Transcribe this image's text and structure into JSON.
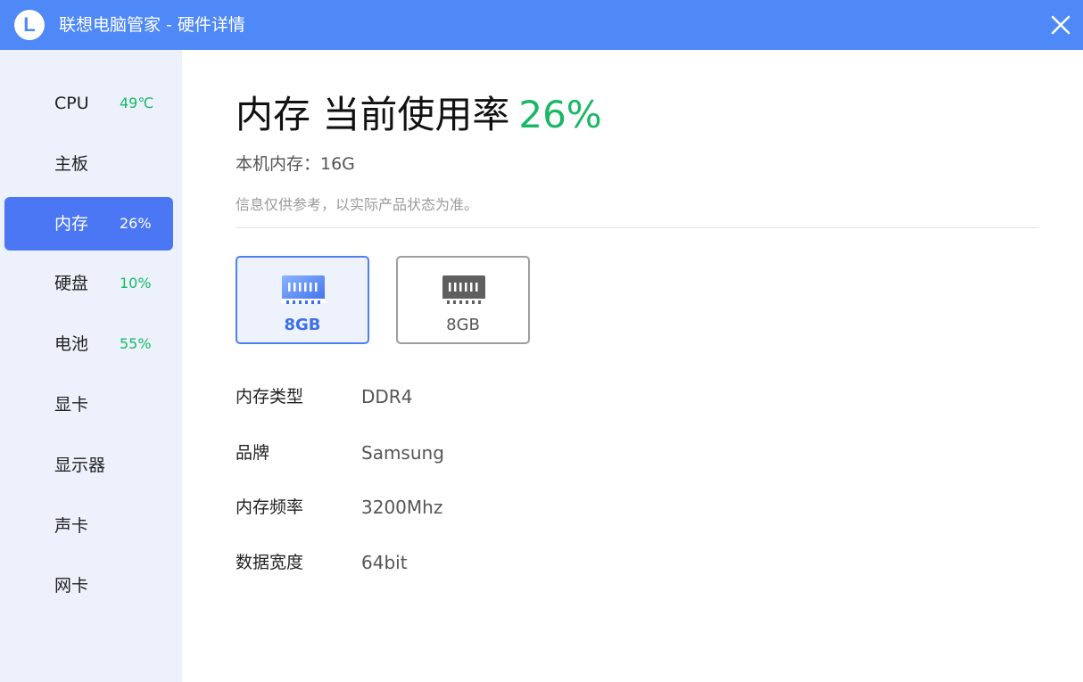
{
  "window": {
    "title": "联想电脑管家 - 硬件详情",
    "logo_letter": "L",
    "accent_color": "#4f88f7"
  },
  "sidebar": {
    "items": [
      {
        "label": "CPU",
        "value": "49℃",
        "active": false
      },
      {
        "label": "主板",
        "value": "",
        "active": false
      },
      {
        "label": "内存",
        "value": "26%",
        "active": true
      },
      {
        "label": "硬盘",
        "value": "10%",
        "active": false
      },
      {
        "label": "电池",
        "value": "55%",
        "active": false
      },
      {
        "label": "显卡",
        "value": "",
        "active": false
      },
      {
        "label": "显示器",
        "value": "",
        "active": false
      },
      {
        "label": "声卡",
        "value": "",
        "active": false
      },
      {
        "label": "网卡",
        "value": "",
        "active": false
      }
    ]
  },
  "main": {
    "heading": "内存 当前使用率",
    "usage_percent": "26%",
    "total_memory": "本机内存：16G",
    "disclaimer": "信息仅供参考，以实际产品状态为准。",
    "slots": [
      {
        "label": "8GB",
        "icon": "ram-module-icon",
        "selected": true
      },
      {
        "label": "8GB",
        "icon": "ram-module-icon",
        "selected": false
      }
    ],
    "specs": [
      {
        "key": "内存类型",
        "value": "DDR4"
      },
      {
        "key": "品牌",
        "value": "Samsung"
      },
      {
        "key": "内存频率",
        "value": "3200Mhz"
      },
      {
        "key": "数据宽度",
        "value": "64bit"
      }
    ]
  }
}
